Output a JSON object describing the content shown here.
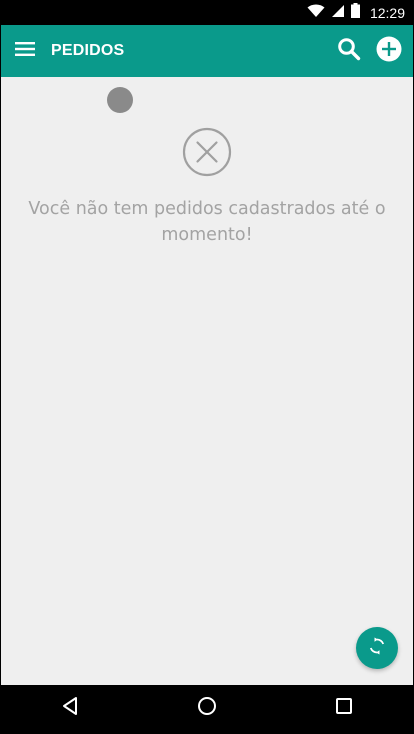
{
  "status_bar": {
    "time": "12:29",
    "icons": [
      "wifi-icon",
      "signal-icon",
      "battery-icon"
    ]
  },
  "app_bar": {
    "title": "PEDIDOS",
    "menu_icon": "menu-icon",
    "search_icon": "search-icon",
    "add_icon": "add-circle-icon"
  },
  "empty_state": {
    "icon": "close-circle-icon",
    "message": "Você não tem pedidos cadastrados até o momento!"
  },
  "fab": {
    "icon": "sync-icon"
  },
  "nav_bar": {
    "back_icon": "back-icon",
    "home_icon": "home-icon",
    "recents_icon": "recents-icon"
  },
  "colors": {
    "primary": "#0a9a8b",
    "background": "#efefef",
    "muted_text": "#a3a3a3"
  }
}
